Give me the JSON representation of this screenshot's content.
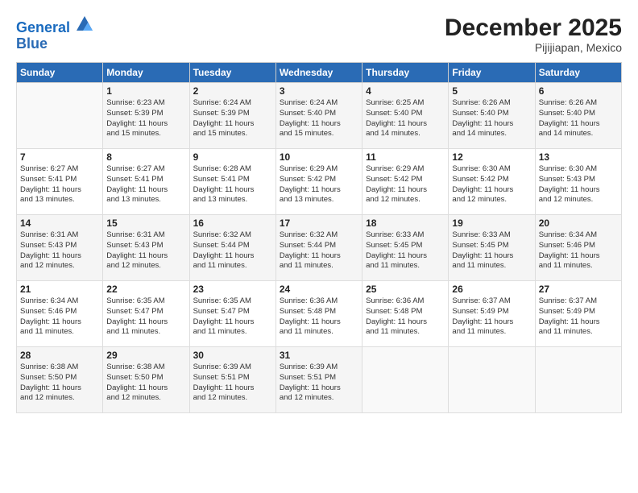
{
  "logo": {
    "line1": "General",
    "line2": "Blue"
  },
  "title": "December 2025",
  "subtitle": "Pijijiapan, Mexico",
  "days_header": [
    "Sunday",
    "Monday",
    "Tuesday",
    "Wednesday",
    "Thursday",
    "Friday",
    "Saturday"
  ],
  "weeks": [
    [
      {
        "num": "",
        "info": ""
      },
      {
        "num": "1",
        "info": "Sunrise: 6:23 AM\nSunset: 5:39 PM\nDaylight: 11 hours\nand 15 minutes."
      },
      {
        "num": "2",
        "info": "Sunrise: 6:24 AM\nSunset: 5:39 PM\nDaylight: 11 hours\nand 15 minutes."
      },
      {
        "num": "3",
        "info": "Sunrise: 6:24 AM\nSunset: 5:40 PM\nDaylight: 11 hours\nand 15 minutes."
      },
      {
        "num": "4",
        "info": "Sunrise: 6:25 AM\nSunset: 5:40 PM\nDaylight: 11 hours\nand 14 minutes."
      },
      {
        "num": "5",
        "info": "Sunrise: 6:26 AM\nSunset: 5:40 PM\nDaylight: 11 hours\nand 14 minutes."
      },
      {
        "num": "6",
        "info": "Sunrise: 6:26 AM\nSunset: 5:40 PM\nDaylight: 11 hours\nand 14 minutes."
      }
    ],
    [
      {
        "num": "7",
        "info": "Sunrise: 6:27 AM\nSunset: 5:41 PM\nDaylight: 11 hours\nand 13 minutes."
      },
      {
        "num": "8",
        "info": "Sunrise: 6:27 AM\nSunset: 5:41 PM\nDaylight: 11 hours\nand 13 minutes."
      },
      {
        "num": "9",
        "info": "Sunrise: 6:28 AM\nSunset: 5:41 PM\nDaylight: 11 hours\nand 13 minutes."
      },
      {
        "num": "10",
        "info": "Sunrise: 6:29 AM\nSunset: 5:42 PM\nDaylight: 11 hours\nand 13 minutes."
      },
      {
        "num": "11",
        "info": "Sunrise: 6:29 AM\nSunset: 5:42 PM\nDaylight: 11 hours\nand 12 minutes."
      },
      {
        "num": "12",
        "info": "Sunrise: 6:30 AM\nSunset: 5:42 PM\nDaylight: 11 hours\nand 12 minutes."
      },
      {
        "num": "13",
        "info": "Sunrise: 6:30 AM\nSunset: 5:43 PM\nDaylight: 11 hours\nand 12 minutes."
      }
    ],
    [
      {
        "num": "14",
        "info": "Sunrise: 6:31 AM\nSunset: 5:43 PM\nDaylight: 11 hours\nand 12 minutes."
      },
      {
        "num": "15",
        "info": "Sunrise: 6:31 AM\nSunset: 5:43 PM\nDaylight: 11 hours\nand 12 minutes."
      },
      {
        "num": "16",
        "info": "Sunrise: 6:32 AM\nSunset: 5:44 PM\nDaylight: 11 hours\nand 11 minutes."
      },
      {
        "num": "17",
        "info": "Sunrise: 6:32 AM\nSunset: 5:44 PM\nDaylight: 11 hours\nand 11 minutes."
      },
      {
        "num": "18",
        "info": "Sunrise: 6:33 AM\nSunset: 5:45 PM\nDaylight: 11 hours\nand 11 minutes."
      },
      {
        "num": "19",
        "info": "Sunrise: 6:33 AM\nSunset: 5:45 PM\nDaylight: 11 hours\nand 11 minutes."
      },
      {
        "num": "20",
        "info": "Sunrise: 6:34 AM\nSunset: 5:46 PM\nDaylight: 11 hours\nand 11 minutes."
      }
    ],
    [
      {
        "num": "21",
        "info": "Sunrise: 6:34 AM\nSunset: 5:46 PM\nDaylight: 11 hours\nand 11 minutes."
      },
      {
        "num": "22",
        "info": "Sunrise: 6:35 AM\nSunset: 5:47 PM\nDaylight: 11 hours\nand 11 minutes."
      },
      {
        "num": "23",
        "info": "Sunrise: 6:35 AM\nSunset: 5:47 PM\nDaylight: 11 hours\nand 11 minutes."
      },
      {
        "num": "24",
        "info": "Sunrise: 6:36 AM\nSunset: 5:48 PM\nDaylight: 11 hours\nand 11 minutes."
      },
      {
        "num": "25",
        "info": "Sunrise: 6:36 AM\nSunset: 5:48 PM\nDaylight: 11 hours\nand 11 minutes."
      },
      {
        "num": "26",
        "info": "Sunrise: 6:37 AM\nSunset: 5:49 PM\nDaylight: 11 hours\nand 11 minutes."
      },
      {
        "num": "27",
        "info": "Sunrise: 6:37 AM\nSunset: 5:49 PM\nDaylight: 11 hours\nand 11 minutes."
      }
    ],
    [
      {
        "num": "28",
        "info": "Sunrise: 6:38 AM\nSunset: 5:50 PM\nDaylight: 11 hours\nand 12 minutes."
      },
      {
        "num": "29",
        "info": "Sunrise: 6:38 AM\nSunset: 5:50 PM\nDaylight: 11 hours\nand 12 minutes."
      },
      {
        "num": "30",
        "info": "Sunrise: 6:39 AM\nSunset: 5:51 PM\nDaylight: 11 hours\nand 12 minutes."
      },
      {
        "num": "31",
        "info": "Sunrise: 6:39 AM\nSunset: 5:51 PM\nDaylight: 11 hours\nand 12 minutes."
      },
      {
        "num": "",
        "info": ""
      },
      {
        "num": "",
        "info": ""
      },
      {
        "num": "",
        "info": ""
      }
    ]
  ]
}
